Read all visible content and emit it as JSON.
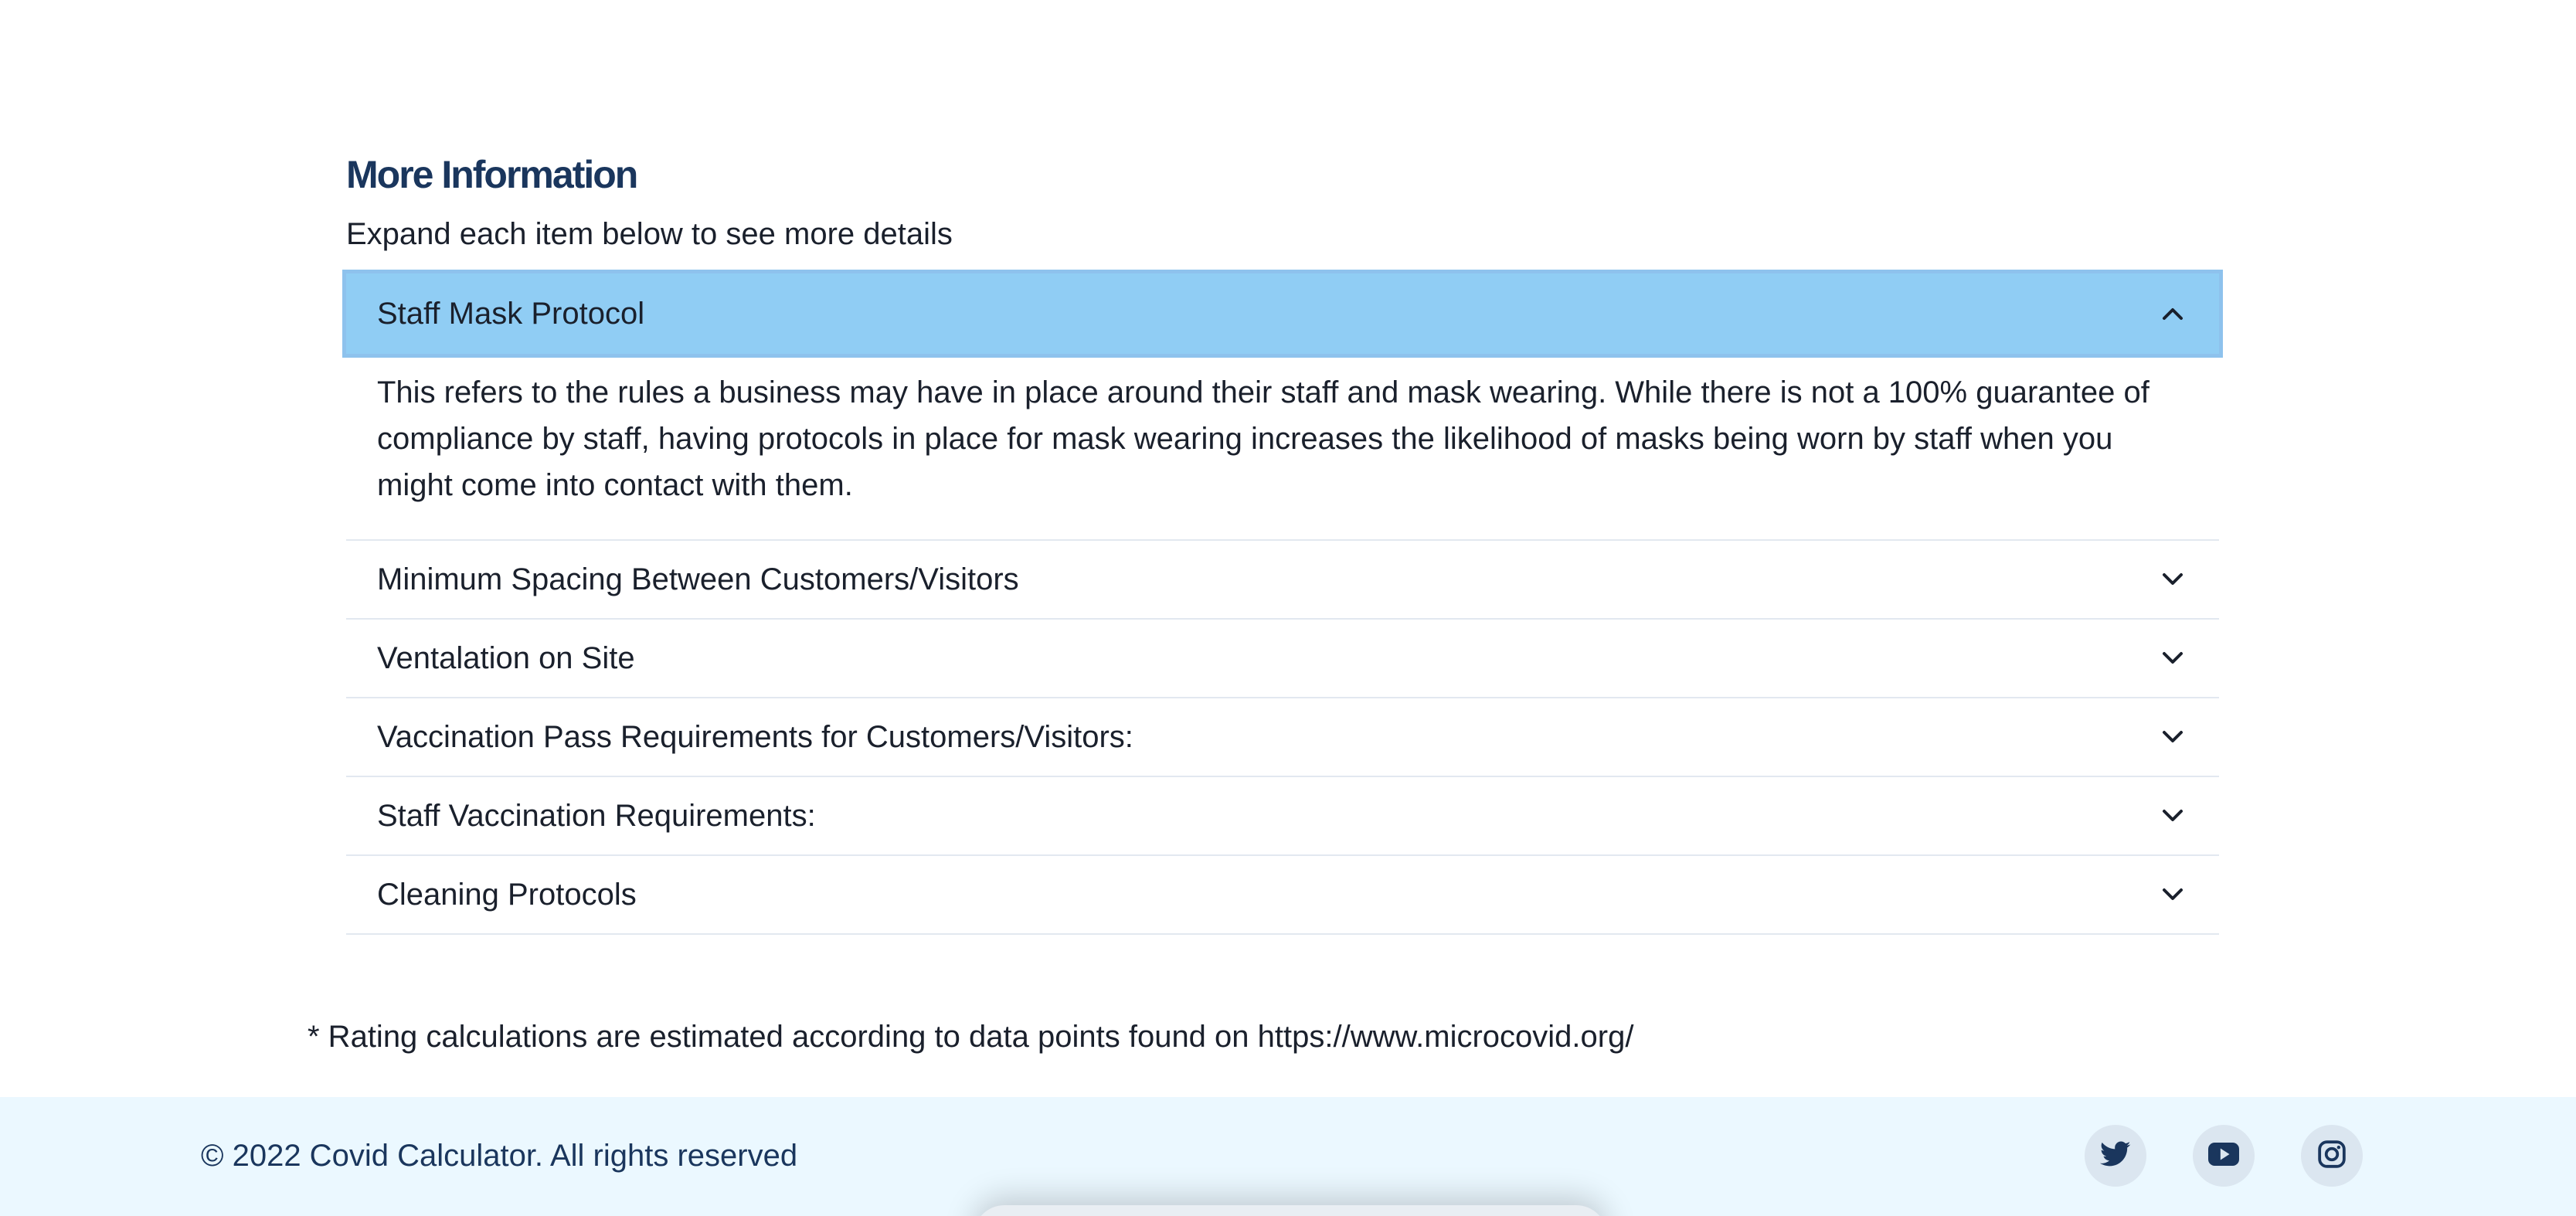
{
  "section": {
    "title": "More Information",
    "subtitle": "Expand each item below to see more details"
  },
  "accordion": {
    "items": [
      {
        "label": "Staff Mask Protocol",
        "expanded": true,
        "body": "This refers to the rules a business may have in place around their staff and mask wearing. While there is not a 100% guarantee of compliance by staff, having protocols in place for mask wearing increases the likelihood of masks being worn by staff when you might come into contact with them."
      },
      {
        "label": "Minimum Spacing Between Customers/Visitors",
        "expanded": false
      },
      {
        "label": "Ventalation on Site",
        "expanded": false
      },
      {
        "label": "Vaccination Pass Requirements for Customers/Visitors:",
        "expanded": false
      },
      {
        "label": "Staff Vaccination Requirements:",
        "expanded": false
      },
      {
        "label": "Cleaning Protocols",
        "expanded": false
      }
    ]
  },
  "footnote": "* Rating calculations are estimated according to data points found on https://www.microcovid.org/",
  "footer": {
    "copyright": "© 2022 Covid Calculator. All rights reserved",
    "socials": [
      {
        "icon": "twitter-icon"
      },
      {
        "icon": "youtube-icon"
      },
      {
        "icon": "instagram-icon"
      }
    ]
  },
  "colors": {
    "heading": "#1a365d",
    "accordion_active_bg": "#90cdf4",
    "footer_bg": "#ebf8ff",
    "divider": "#e2e8f0"
  }
}
